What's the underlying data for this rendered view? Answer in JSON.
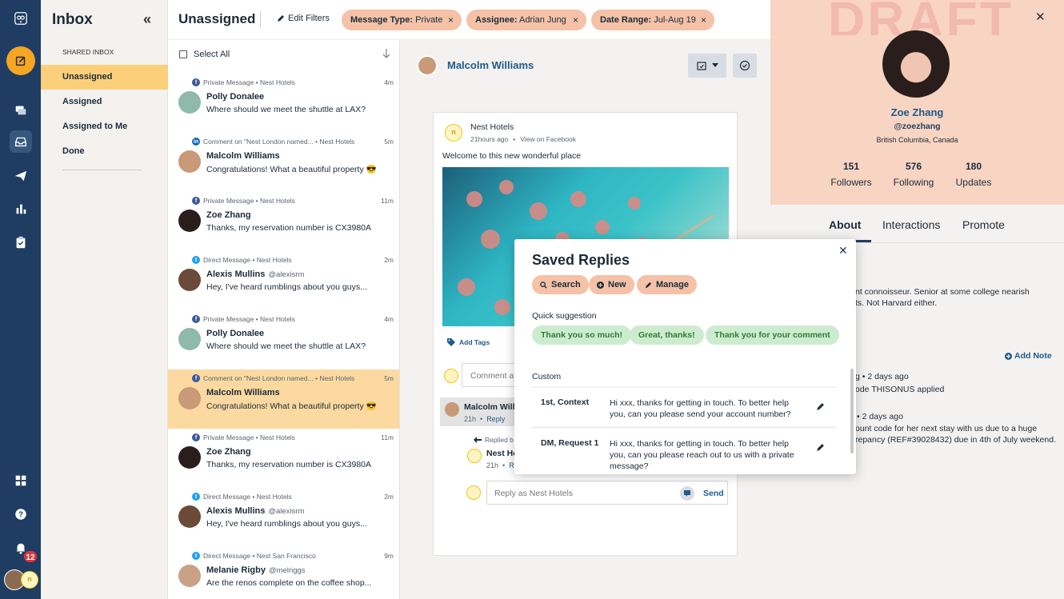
{
  "nav": {
    "notification_count": "12"
  },
  "inbox": {
    "title": "Inbox",
    "collapse": "«",
    "section": "SHARED INBOX",
    "items": [
      {
        "label": "Unassigned",
        "active": true
      },
      {
        "label": "Assigned"
      },
      {
        "label": "Assigned to Me"
      },
      {
        "label": "Done"
      }
    ]
  },
  "topbar": {
    "title": "Unassigned",
    "edit_filters": "Edit Filters",
    "chips": [
      {
        "key": "Message Type:",
        "value": "Private"
      },
      {
        "key": "Assignee:",
        "value": "Adrian Jung"
      },
      {
        "key": "Date Range:",
        "value": "Jul-Aug 19"
      }
    ],
    "chip_close": "×"
  },
  "list": {
    "select_all": "Select All",
    "items": [
      {
        "network": "facebook",
        "meta": "Private Message  •  Nest Hotels",
        "time": "4m",
        "name": "Polly Donalee",
        "handle": "",
        "text": "Where should we meet the shuttle at LAX?"
      },
      {
        "network": "linkedin",
        "meta": "Comment on \"Nest London named...  •  Nest Hotels",
        "time": "5m",
        "name": "Malcolm Williams",
        "handle": "",
        "text": "Congratulations! What a beautiful property 😎"
      },
      {
        "network": "facebook",
        "meta": "Private Message  •  Nest Hotels",
        "time": "11m",
        "name": "Zoe Zhang",
        "handle": "",
        "text": "Thanks, my reservation number is CX3980A"
      },
      {
        "network": "twitter",
        "meta": "Direct Message  •  Nest Hotels",
        "time": "2m",
        "name": "Alexis Mullins",
        "handle": "@alexisrm",
        "text": "Hey, I've heard rumblings about you guys..."
      },
      {
        "network": "facebook",
        "meta": "Private Message  •  Nest Hotels",
        "time": "4m",
        "name": "Polly Donalee",
        "handle": "",
        "text": "Where should we meet the shuttle at LAX?"
      },
      {
        "network": "facebook",
        "meta": "Comment on \"Nest London named...  •  Nest Hotels",
        "time": "5m",
        "name": "Malcolm Williams",
        "handle": "",
        "text": "Congratulations! What a beautiful property 😎",
        "selected": true
      },
      {
        "network": "facebook",
        "meta": "Private Message  •  Nest Hotels",
        "time": "11m",
        "name": "Zoe Zhang",
        "handle": "",
        "text": "Thanks, my reservation number is CX3980A"
      },
      {
        "network": "twitter",
        "meta": "Direct Message  •  Nest Hotels",
        "time": "2m",
        "name": "Alexis Mullins",
        "handle": "@alexisrm",
        "text": "Hey, I've heard rumblings about you guys..."
      },
      {
        "network": "twitter",
        "meta": "Direct Message  •  Nest San Francisco",
        "time": "9m",
        "name": "Melanie Rigby",
        "handle": "@melriggs",
        "text": "Are the renos complete on the coffee shop..."
      }
    ]
  },
  "conversation": {
    "name": "Malcolm Williams",
    "post": {
      "author": "Nest Hotels",
      "time": "21hours ago",
      "view_link": "View on Facebook",
      "text": "Welcome to this new wonderful place",
      "add_tags": "Add Tags"
    },
    "comment_placeholder": "Comment a",
    "comment": {
      "name": "Malcolm Willi",
      "time": "21h",
      "reply": "Reply"
    },
    "replied": {
      "label": "Replied b",
      "name": "Nest Ho",
      "time": "21h",
      "reply": "R"
    },
    "reply_placeholder": "Reply as Nest Hotels",
    "send": "Send"
  },
  "modal": {
    "title": "Saved Replies",
    "close": "✕",
    "buttons": {
      "search": "Search",
      "new": "New",
      "manage": "Manage"
    },
    "quick_title": "Quick suggestion",
    "quick": [
      "Thank you so much!",
      "Great, thanks!",
      "Thank you for your comment"
    ],
    "custom_title": "Custom",
    "custom": [
      {
        "key": "1st, Context",
        "text": "Hi xxx, thanks for getting in touch. To better help you, can you please send your account number?"
      },
      {
        "key": "DM, Request 1",
        "text": "Hi xxx, thanks for getting in touch. To better help you, can you please reach out to us with a private message?"
      }
    ]
  },
  "profile": {
    "watermark": "DRAFT",
    "close": "✕",
    "name": "Zoe Zhang",
    "handle": "@zoezhang",
    "location": "British Columbia, Canada",
    "stats": [
      {
        "value": "151",
        "label": "Followers"
      },
      {
        "value": "576",
        "label": "Following"
      },
      {
        "value": "180",
        "label": "Updates"
      }
    ],
    "tabs": [
      "About",
      "Interactions",
      "Promote"
    ],
    "bio_line1": "nt connoisseur. Senior at some college nearish",
    "bio_line2": "ts. Not Harvard either.",
    "add_note": "Add Note",
    "notes": [
      {
        "head": "g  •  2 days ago",
        "body": "ode THISONUS applied"
      },
      {
        "head": "•  2 days ago",
        "body": "ount code for her next stay with us due to a huge",
        "body2": "repancy (REF#39028432) due in 4th of July weekend."
      }
    ]
  },
  "colors": {
    "nav": "#1f3d63",
    "accent": "#fcd07a",
    "chip": "#f5c2a7",
    "profile": "#f8d4c2",
    "link": "#1f5b8a"
  }
}
